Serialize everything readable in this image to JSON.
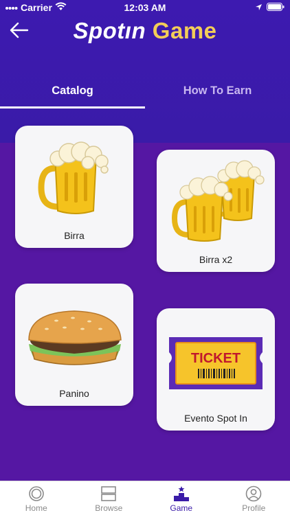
{
  "status_bar": {
    "carrier": "Carrier",
    "time": "12:03 AM",
    "icons": [
      "wifi-icon",
      "location-arrow-icon",
      "battery-icon"
    ]
  },
  "header": {
    "back_icon": "arrow-left-icon",
    "title_brand": "Spotın",
    "title_accent": "Game",
    "colors": {
      "background": "#3d1ab0",
      "accent": "#f3cd58"
    }
  },
  "tabs": [
    {
      "label": "Catalog",
      "active": true
    },
    {
      "label": "How To Earn",
      "active": false
    }
  ],
  "catalog": {
    "items": [
      {
        "label": "Birra",
        "icon": "beer-mug-icon"
      },
      {
        "label": "Birra x2",
        "icon": "two-beer-mugs-icon"
      },
      {
        "label": "Panino",
        "icon": "burger-icon"
      },
      {
        "label": "Evento Spot In",
        "icon": "ticket-icon",
        "ticket_text": "TICKET"
      }
    ]
  },
  "bottom_nav": {
    "items": [
      {
        "label": "Home",
        "icon": "home-circle-icon",
        "active": false
      },
      {
        "label": "Browse",
        "icon": "browse-icon",
        "active": false
      },
      {
        "label": "Game",
        "icon": "podium-icon",
        "active": true
      },
      {
        "label": "Profile",
        "icon": "profile-icon",
        "active": false
      }
    ]
  }
}
